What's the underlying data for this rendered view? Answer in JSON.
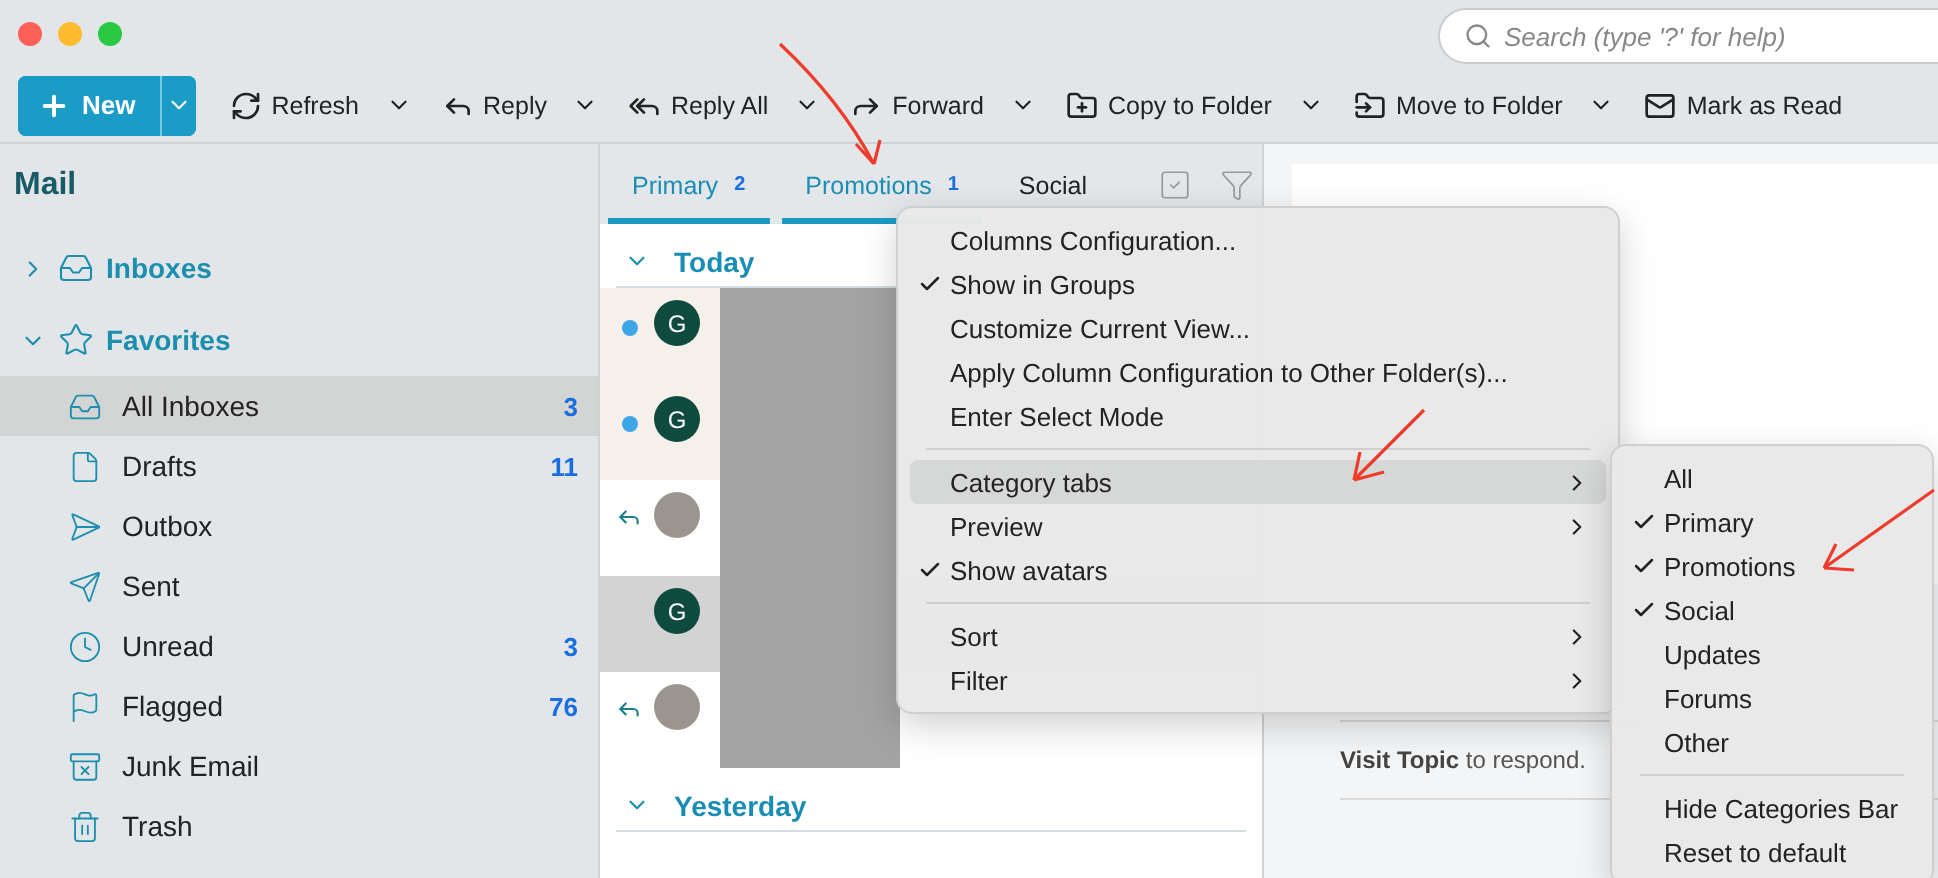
{
  "search": {
    "placeholder": "Search (type '?' for help)"
  },
  "toolbar": {
    "new_button": {
      "label": "New"
    },
    "buttons": [
      {
        "label": "Refresh",
        "has_menu": true
      },
      {
        "label": "Reply",
        "has_menu": true
      },
      {
        "label": "Reply All",
        "has_menu": true
      },
      {
        "label": "Forward",
        "has_menu": true
      },
      {
        "label": "Copy to Folder",
        "has_menu": true
      },
      {
        "label": "Move to Folder",
        "has_menu": true
      },
      {
        "label": "Mark as Read",
        "has_menu": false
      }
    ]
  },
  "sidebar": {
    "title": "Mail",
    "groups": [
      {
        "label": "Inboxes",
        "expanded": false
      },
      {
        "label": "Favorites",
        "expanded": true,
        "items": [
          {
            "label": "All Inboxes",
            "count": "3",
            "selected": true
          },
          {
            "label": "Drafts",
            "count": "11",
            "selected": false
          },
          {
            "label": "Outbox",
            "selected": false
          },
          {
            "label": "Sent",
            "selected": false
          },
          {
            "label": "Unread",
            "count": "3",
            "selected": false
          },
          {
            "label": "Flagged",
            "count": "76",
            "selected": false
          },
          {
            "label": "Junk Email",
            "selected": false
          },
          {
            "label": "Trash",
            "selected": false
          }
        ]
      }
    ]
  },
  "message_list": {
    "tabs": [
      {
        "label": "Primary",
        "count": "2",
        "active": true
      },
      {
        "label": "Promotions",
        "count": "1",
        "active": true
      },
      {
        "label": "Social",
        "active": false
      }
    ],
    "groups": [
      {
        "label": "Today",
        "expanded": true,
        "messages": [
          {
            "avatar": "G",
            "kind": "letter",
            "unread": true,
            "selected": false
          },
          {
            "avatar": "G",
            "kind": "letter",
            "unread": true,
            "selected": false
          },
          {
            "kind": "photo",
            "replied": true,
            "selected": false
          },
          {
            "avatar": "G",
            "kind": "letter",
            "selected": true
          },
          {
            "kind": "photo",
            "replied": true,
            "selected": false
          }
        ]
      },
      {
        "label": "Yesterday",
        "expanded": true
      }
    ]
  },
  "context_menu": {
    "items": [
      {
        "kind": "item",
        "label": "Columns Configuration..."
      },
      {
        "kind": "item",
        "label": "Show in Groups",
        "checked": true
      },
      {
        "kind": "item",
        "label": "Customize Current View..."
      },
      {
        "kind": "item",
        "label": "Apply Column Configuration to Other Folder(s)..."
      },
      {
        "kind": "item",
        "label": "Enter Select Mode"
      },
      {
        "kind": "separator"
      },
      {
        "kind": "item",
        "label": "Category tabs",
        "submenu": true,
        "highlighted": true
      },
      {
        "kind": "item",
        "label": "Preview",
        "submenu": true
      },
      {
        "kind": "item",
        "label": "Show avatars",
        "checked": true
      },
      {
        "kind": "separator"
      },
      {
        "kind": "item",
        "label": "Sort",
        "submenu": true
      },
      {
        "kind": "item",
        "label": "Filter",
        "submenu": true
      }
    ]
  },
  "submenu": {
    "items": [
      {
        "kind": "item",
        "label": "All"
      },
      {
        "kind": "item",
        "label": "Primary",
        "checked": true
      },
      {
        "kind": "item",
        "label": "Promotions",
        "checked": true
      },
      {
        "kind": "item",
        "label": "Social",
        "checked": true
      },
      {
        "kind": "item",
        "label": "Updates"
      },
      {
        "kind": "item",
        "label": "Forums"
      },
      {
        "kind": "item",
        "label": "Other"
      },
      {
        "kind": "separator"
      },
      {
        "kind": "item",
        "label": "Hide Categories Bar"
      },
      {
        "kind": "item",
        "label": "Reset to default"
      }
    ]
  },
  "reading_pane": {
    "footer": "**Visit Topic** to respond."
  }
}
